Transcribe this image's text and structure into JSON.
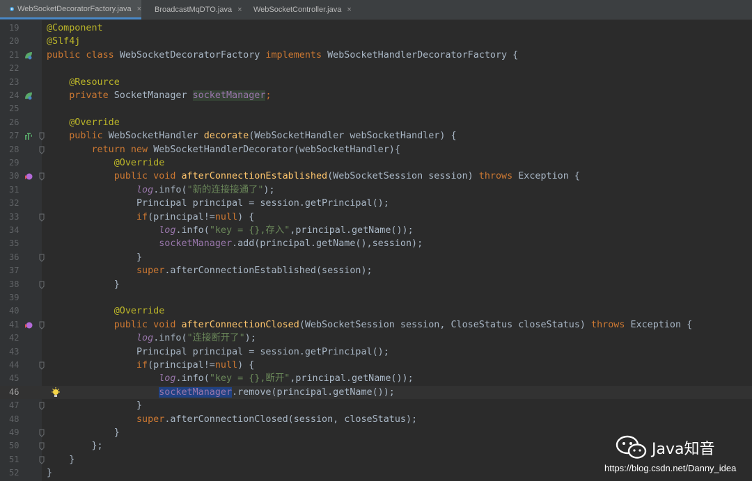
{
  "tabs": [
    {
      "label": "WebSocketDecoratorFactory.java",
      "active": true,
      "icon": "java-class-icon"
    },
    {
      "label": "BroadcastMqDTO.java",
      "active": false,
      "icon": "java-class-icon"
    },
    {
      "label": "WebSocketController.java",
      "active": false,
      "icon": "java-class-icon"
    }
  ],
  "close_glyph": "×",
  "caret_line": 46,
  "lines": [
    {
      "n": "19",
      "tokens": [
        {
          "t": "@Component",
          "c": "ann"
        }
      ]
    },
    {
      "n": "20",
      "tokens": [
        {
          "t": "@Slf4j",
          "c": "ann"
        }
      ]
    },
    {
      "n": "21",
      "gutter_icon": "bean-icon",
      "tokens": [
        {
          "t": "public class ",
          "c": "kw"
        },
        {
          "t": "WebSocketDecoratorFactory "
        },
        {
          "t": "implements ",
          "c": "kw"
        },
        {
          "t": "WebSocketHandlerDecoratorFactory {"
        }
      ]
    },
    {
      "n": "22",
      "tokens": []
    },
    {
      "n": "23",
      "tokens": [
        {
          "t": "    "
        },
        {
          "t": "@Resource",
          "c": "ann"
        }
      ]
    },
    {
      "n": "24",
      "gutter_icon": "bean-icon",
      "tokens": [
        {
          "t": "    "
        },
        {
          "t": "private ",
          "c": "kw"
        },
        {
          "t": "SocketManager "
        },
        {
          "t": "socketManager",
          "c": "fld hl"
        },
        {
          "t": ";",
          "c": "kw"
        }
      ]
    },
    {
      "n": "25",
      "tokens": []
    },
    {
      "n": "26",
      "tokens": [
        {
          "t": "    "
        },
        {
          "t": "@Override",
          "c": "ann"
        }
      ]
    },
    {
      "n": "27",
      "gutter_icon": "implement-icon",
      "fold": true,
      "tokens": [
        {
          "t": "    "
        },
        {
          "t": "public ",
          "c": "kw"
        },
        {
          "t": "WebSocketHandler "
        },
        {
          "t": "decorate",
          "c": "fn"
        },
        {
          "t": "(WebSocketHandler webSocketHandler) {"
        }
      ]
    },
    {
      "n": "28",
      "fold": true,
      "tokens": [
        {
          "t": "        "
        },
        {
          "t": "return new ",
          "c": "kw"
        },
        {
          "t": "WebSocketHandlerDecorator(webSocketHandler){"
        }
      ]
    },
    {
      "n": "29",
      "tokens": [
        {
          "t": "            "
        },
        {
          "t": "@Override",
          "c": "ann"
        }
      ]
    },
    {
      "n": "30",
      "gutter_icon": "override-icon",
      "fold": true,
      "tokens": [
        {
          "t": "            "
        },
        {
          "t": "public void ",
          "c": "kw"
        },
        {
          "t": "afterConnectionEstablished",
          "c": "fn"
        },
        {
          "t": "(WebSocketSession session) "
        },
        {
          "t": "throws ",
          "c": "kw"
        },
        {
          "t": "Exception {"
        }
      ]
    },
    {
      "n": "31",
      "tokens": [
        {
          "t": "                "
        },
        {
          "t": "log",
          "c": "itl"
        },
        {
          "t": ".info("
        },
        {
          "t": "\"新的连接接通了\"",
          "c": "str"
        },
        {
          "t": ");"
        }
      ]
    },
    {
      "n": "32",
      "tokens": [
        {
          "t": "                Principal principal = session.getPrincipal();"
        }
      ]
    },
    {
      "n": "33",
      "fold": true,
      "tokens": [
        {
          "t": "                "
        },
        {
          "t": "if",
          "c": "kw"
        },
        {
          "t": "(principal!="
        },
        {
          "t": "null",
          "c": "kw"
        },
        {
          "t": ") {"
        }
      ]
    },
    {
      "n": "34",
      "tokens": [
        {
          "t": "                    "
        },
        {
          "t": "log",
          "c": "itl"
        },
        {
          "t": ".info("
        },
        {
          "t": "\"key = {},存入\"",
          "c": "str"
        },
        {
          "t": ",principal.getName());"
        }
      ]
    },
    {
      "n": "35",
      "tokens": [
        {
          "t": "                    "
        },
        {
          "t": "socketManager",
          "c": "fld"
        },
        {
          "t": ".add(principal.getName(),session);"
        }
      ]
    },
    {
      "n": "36",
      "fold": true,
      "tokens": [
        {
          "t": "                }"
        }
      ]
    },
    {
      "n": "37",
      "tokens": [
        {
          "t": "                "
        },
        {
          "t": "super",
          "c": "kw"
        },
        {
          "t": ".afterConnectionEstablished(session);"
        }
      ]
    },
    {
      "n": "38",
      "fold": true,
      "tokens": [
        {
          "t": "            }"
        }
      ]
    },
    {
      "n": "39",
      "tokens": []
    },
    {
      "n": "40",
      "tokens": [
        {
          "t": "            "
        },
        {
          "t": "@Override",
          "c": "ann"
        }
      ]
    },
    {
      "n": "41",
      "gutter_icon": "override-icon",
      "fold": true,
      "tokens": [
        {
          "t": "            "
        },
        {
          "t": "public void ",
          "c": "kw"
        },
        {
          "t": "afterConnectionClosed",
          "c": "fn"
        },
        {
          "t": "(WebSocketSession session, CloseStatus closeStatus) "
        },
        {
          "t": "throws ",
          "c": "kw"
        },
        {
          "t": "Exception {"
        }
      ]
    },
    {
      "n": "42",
      "tokens": [
        {
          "t": "                "
        },
        {
          "t": "log",
          "c": "itl"
        },
        {
          "t": ".info("
        },
        {
          "t": "\"连接断开了\"",
          "c": "str"
        },
        {
          "t": ");"
        }
      ]
    },
    {
      "n": "43",
      "tokens": [
        {
          "t": "                Principal principal = session.getPrincipal();"
        }
      ]
    },
    {
      "n": "44",
      "fold": true,
      "tokens": [
        {
          "t": "                "
        },
        {
          "t": "if",
          "c": "kw"
        },
        {
          "t": "(principal!="
        },
        {
          "t": "null",
          "c": "kw"
        },
        {
          "t": ") {"
        }
      ]
    },
    {
      "n": "45",
      "tokens": [
        {
          "t": "                    "
        },
        {
          "t": "log",
          "c": "itl"
        },
        {
          "t": ".info("
        },
        {
          "t": "\"key = {},断开\"",
          "c": "str"
        },
        {
          "t": ",principal.getName());"
        }
      ]
    },
    {
      "n": "46",
      "bulb": true,
      "tokens": [
        {
          "t": "                    "
        },
        {
          "t": "socketManager",
          "c": "fld sel"
        },
        {
          "t": ".remove(principal.getName());"
        }
      ]
    },
    {
      "n": "47",
      "fold": true,
      "tokens": [
        {
          "t": "                }"
        }
      ]
    },
    {
      "n": "48",
      "tokens": [
        {
          "t": "                "
        },
        {
          "t": "super",
          "c": "kw"
        },
        {
          "t": ".afterConnectionClosed(session, closeStatus);"
        }
      ]
    },
    {
      "n": "49",
      "fold": true,
      "tokens": [
        {
          "t": "            }"
        }
      ]
    },
    {
      "n": "50",
      "fold": true,
      "tokens": [
        {
          "t": "        };"
        }
      ]
    },
    {
      "n": "51",
      "fold": true,
      "tokens": [
        {
          "t": "    }"
        }
      ]
    },
    {
      "n": "52",
      "tokens": [
        {
          "t": "}"
        }
      ]
    }
  ],
  "watermark": {
    "title": "Java知音",
    "url": "https://blog.csdn.net/Danny_idea",
    "icon": "wechat-icon"
  },
  "colors": {
    "keyword": "#cc7832",
    "annotation": "#bbb529",
    "string": "#6a8759",
    "field": "#9876aa",
    "method": "#ffc66d",
    "text": "#a9b7c6",
    "background": "#2b2b2b"
  }
}
